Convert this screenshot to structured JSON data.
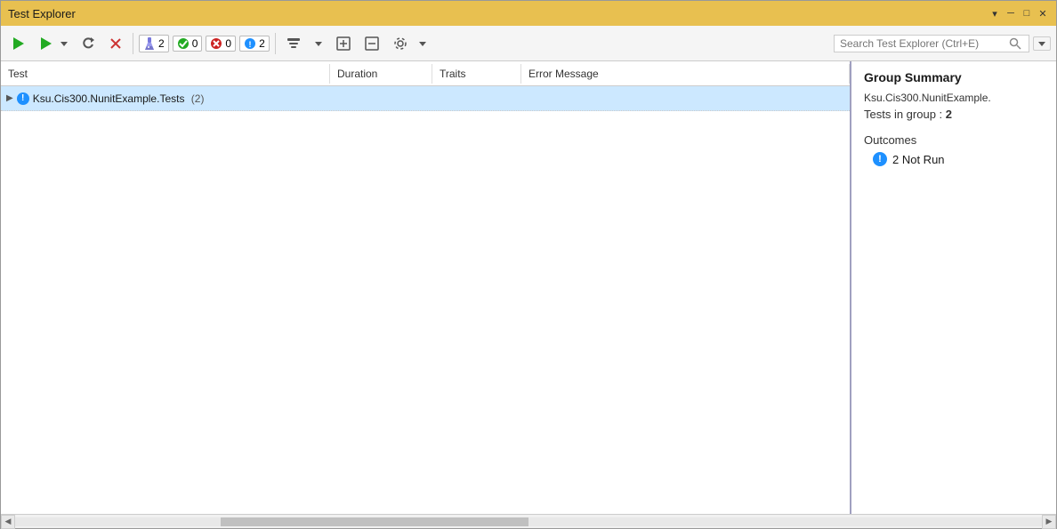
{
  "window": {
    "title": "Test Explorer"
  },
  "titlebar": {
    "title": "Test Explorer",
    "controls": {
      "dropdown": "▾",
      "minimize": "─",
      "maximize": "□",
      "close": "✕"
    }
  },
  "toolbar": {
    "run_all_label": "▶",
    "run_label": "▶",
    "run_dropdown": "▾",
    "refresh_label": "↺",
    "cancel_label": "✕",
    "flask_count": "2",
    "pass_count": "0",
    "fail_count": "0",
    "notrun_count": "2",
    "search_placeholder": "Search Test Explorer (Ctrl+E)"
  },
  "columns": {
    "test": "Test",
    "duration": "Duration",
    "traits": "Traits",
    "error": "Error Message"
  },
  "test_items": [
    {
      "name": "Ksu.Cis300.NunitExample.Tests",
      "count": "(2)",
      "status": "not-run"
    }
  ],
  "summary": {
    "title": "Group Summary",
    "group_name": "Ksu.Cis300.NunitExample.",
    "tests_in_group_label": "Tests in group :",
    "tests_in_group_value": "2",
    "outcomes_label": "Outcomes",
    "not_run_label": "2 Not  Run"
  },
  "scrollbar": {
    "left_arrow": "◀",
    "right_arrow": "▶"
  }
}
